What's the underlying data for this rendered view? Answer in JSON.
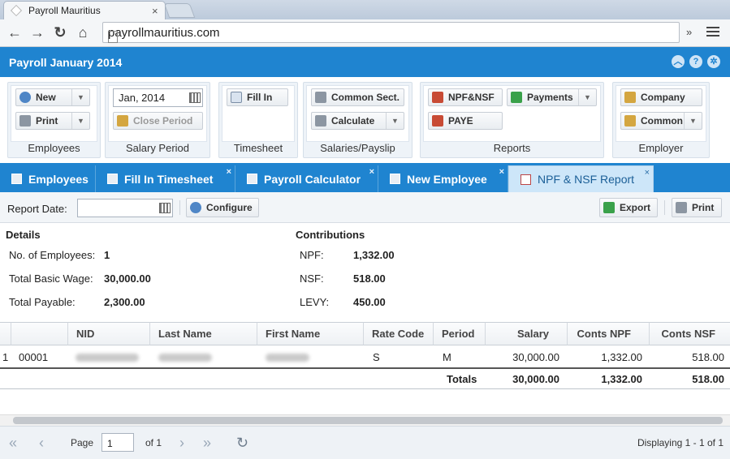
{
  "browser": {
    "tab_title": "Payroll Mauritius",
    "tab_close": "×",
    "url": "payrollmauritius.com",
    "ext_label": "»"
  },
  "app": {
    "title": "Payroll January 2014",
    "accent": "#1f84d0"
  },
  "ribbon": {
    "employees": {
      "label": "Employees",
      "new": "New",
      "print": "Print"
    },
    "salary_period": {
      "label": "Salary Period",
      "date": "Jan, 2014",
      "close": "Close Period"
    },
    "timesheet": {
      "label": "Timesheet",
      "fill_in": "Fill In"
    },
    "salaries": {
      "label": "Salaries/Payslip",
      "common_sect": "Common Sect.",
      "calculate": "Calculate"
    },
    "reports": {
      "label": "Reports",
      "npf_nsf": "NPF&NSF",
      "payments": "Payments",
      "paye": "PAYE"
    },
    "employer": {
      "label": "Employer",
      "company": "Company",
      "common": "Common"
    }
  },
  "tabs": [
    {
      "label": "Employees",
      "closable": false
    },
    {
      "label": "Fill In Timesheet",
      "closable": true
    },
    {
      "label": "Payroll Calculator",
      "closable": true
    },
    {
      "label": "New Employee",
      "closable": true
    },
    {
      "label": "NPF & NSF Report",
      "closable": true,
      "active": true
    }
  ],
  "tab_close_symbol": "×",
  "report_bar": {
    "date_label": "Report Date:",
    "date_value": "",
    "configure": "Configure",
    "export": "Export",
    "print": "Print"
  },
  "details": {
    "title": "Details",
    "rows": [
      {
        "label": "No. of Employees:",
        "value": "1"
      },
      {
        "label": "Total Basic Wage:",
        "value": "30,000.00"
      },
      {
        "label": "Total Payable:",
        "value": "2,300.00"
      }
    ]
  },
  "contributions": {
    "title": "Contributions",
    "rows": [
      {
        "label": "NPF:",
        "value": "1,332.00"
      },
      {
        "label": "NSF:",
        "value": "518.00"
      },
      {
        "label": "LEVY:",
        "value": "450.00"
      }
    ]
  },
  "grid": {
    "columns": [
      "NID",
      "Last Name",
      "First Name",
      "Rate Code",
      "Period",
      "Salary",
      "Conts NPF",
      "Conts NSF"
    ],
    "rows": [
      {
        "num": "1",
        "id": "00001",
        "nid": "",
        "last_name": "",
        "first_name": "",
        "rate_code": "S",
        "period": "M",
        "salary": "30,000.00",
        "conts_npf": "1,332.00",
        "conts_nsf": "518.00"
      }
    ],
    "totals": {
      "label": "Totals",
      "salary": "30,000.00",
      "conts_npf": "1,332.00",
      "conts_nsf": "518.00"
    }
  },
  "pager": {
    "page_label": "Page",
    "page_value": "1",
    "of_label": "of 1",
    "displaying": "Displaying 1 - 1 of 1"
  }
}
